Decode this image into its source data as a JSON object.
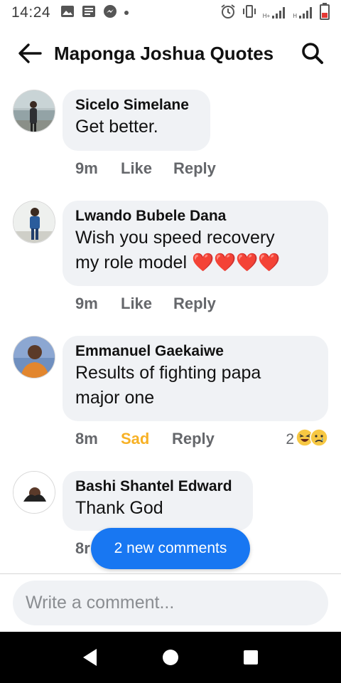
{
  "status_bar": {
    "time": "14:24",
    "net1": "H+",
    "net2": "H",
    "left_icons": [
      "image-icon",
      "news-icon",
      "messenger-icon",
      "dot-icon"
    ],
    "right_icons": [
      "alarm-icon",
      "vibrate-icon",
      "signal-icon",
      "signal-icon",
      "battery-icon"
    ]
  },
  "header": {
    "title": "Maponga Joshua Quotes",
    "back_icon": "arrow-left-icon",
    "search_icon": "search-icon"
  },
  "comments": [
    {
      "author": "Sicelo Simelane",
      "lines": [
        "Get better."
      ],
      "time": "9m",
      "action1": "Like",
      "action2": "Reply"
    },
    {
      "author": "Lwando Bubele Dana",
      "lines": [
        "Wish you speed recovery",
        "my role model ❤️❤️❤️❤️"
      ],
      "time": "9m",
      "action1": "Like",
      "action2": "Reply"
    },
    {
      "author": "Emmanuel Gaekaiwe",
      "lines": [
        "Results of fighting papa",
        "major one"
      ],
      "time": "8m",
      "action1": "Sad",
      "action2": "Reply",
      "reaction_count": "2",
      "reactions": [
        "laughing-emoji",
        "sad-emoji"
      ]
    },
    {
      "author": "Bashi Shantel Edward",
      "lines": [
        "Thank God"
      ],
      "time": "8r"
    }
  ],
  "new_comments_label": "2 new comments",
  "composer": {
    "placeholder": "Write a comment..."
  },
  "colors": {
    "accent": "#1877f2",
    "sad": "#f7b125",
    "bubble": "#f0f2f5",
    "meta": "#65676b"
  }
}
